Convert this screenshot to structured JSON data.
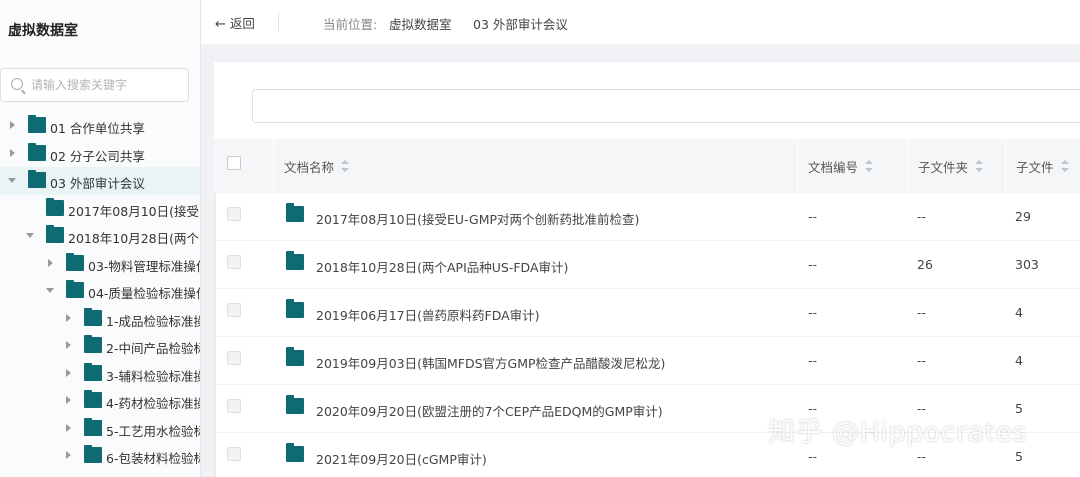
{
  "sidebar": {
    "title": "虚拟数据室",
    "search_placeholder": "请输入搜索关键字",
    "tree": [
      {
        "label": "01 合作单位共享",
        "caret": "right",
        "level": 0
      },
      {
        "label": "02 分子公司共享",
        "caret": "right",
        "level": 0
      },
      {
        "label": "03 外部审计会议",
        "caret": "down",
        "level": 0,
        "active": true
      },
      {
        "label": "2017年08月10日(接受",
        "caret": "none",
        "level": 1
      },
      {
        "label": "2018年10月28日(两个",
        "caret": "down",
        "level": 1
      },
      {
        "label": "03-物料管理标准操作",
        "caret": "right",
        "level": 2
      },
      {
        "label": "04-质量检验标准操作",
        "caret": "down",
        "level": 2
      },
      {
        "label": "1-成品检验标准操",
        "caret": "right",
        "level": 3
      },
      {
        "label": "2-中间产品检验标",
        "caret": "right",
        "level": 3
      },
      {
        "label": "3-辅料检验标准操",
        "caret": "right",
        "level": 3
      },
      {
        "label": "4-药材检验标准操",
        "caret": "right",
        "level": 3
      },
      {
        "label": "5-工艺用水检验标",
        "caret": "right",
        "level": 3
      },
      {
        "label": "6-包装材料检验标",
        "caret": "right",
        "level": 3
      }
    ]
  },
  "topbar": {
    "back_arrow": "←",
    "back_label": "返回",
    "breadcrumb_label": "当前位置:",
    "breadcrumb": [
      "虚拟数据室",
      "03 外部审计会议"
    ]
  },
  "table": {
    "columns": [
      "文档名称",
      "文档编号",
      "子文件夹",
      "子文件"
    ],
    "rows": [
      {
        "name": "2017年08月10日(接受EU-GMP对两个创新药批准前检查)",
        "doc_no": "--",
        "subfolders": "--",
        "subfiles": "29"
      },
      {
        "name": "2018年10月28日(两个API品种US-FDA审计)",
        "doc_no": "--",
        "subfolders": "26",
        "subfiles": "303"
      },
      {
        "name": "2019年06月17日(兽药原料药FDA审计)",
        "doc_no": "--",
        "subfolders": "--",
        "subfiles": "4"
      },
      {
        "name": "2019年09月03日(韩国MFDS官方GMP检查产品醋酸泼尼松龙)",
        "doc_no": "--",
        "subfolders": "--",
        "subfiles": "4"
      },
      {
        "name": "2020年09月20日(欧盟注册的7个CEP产品EDQM的GMP审计)",
        "doc_no": "--",
        "subfolders": "--",
        "subfiles": "5"
      },
      {
        "name": "2021年09月20日(cGMP审计)",
        "doc_no": "--",
        "subfolders": "--",
        "subfiles": "5"
      }
    ]
  },
  "watermark": "知乎 @Hippocrates",
  "colors": {
    "folder": "#0f6b73",
    "active_bg": "#eaf4f4"
  }
}
